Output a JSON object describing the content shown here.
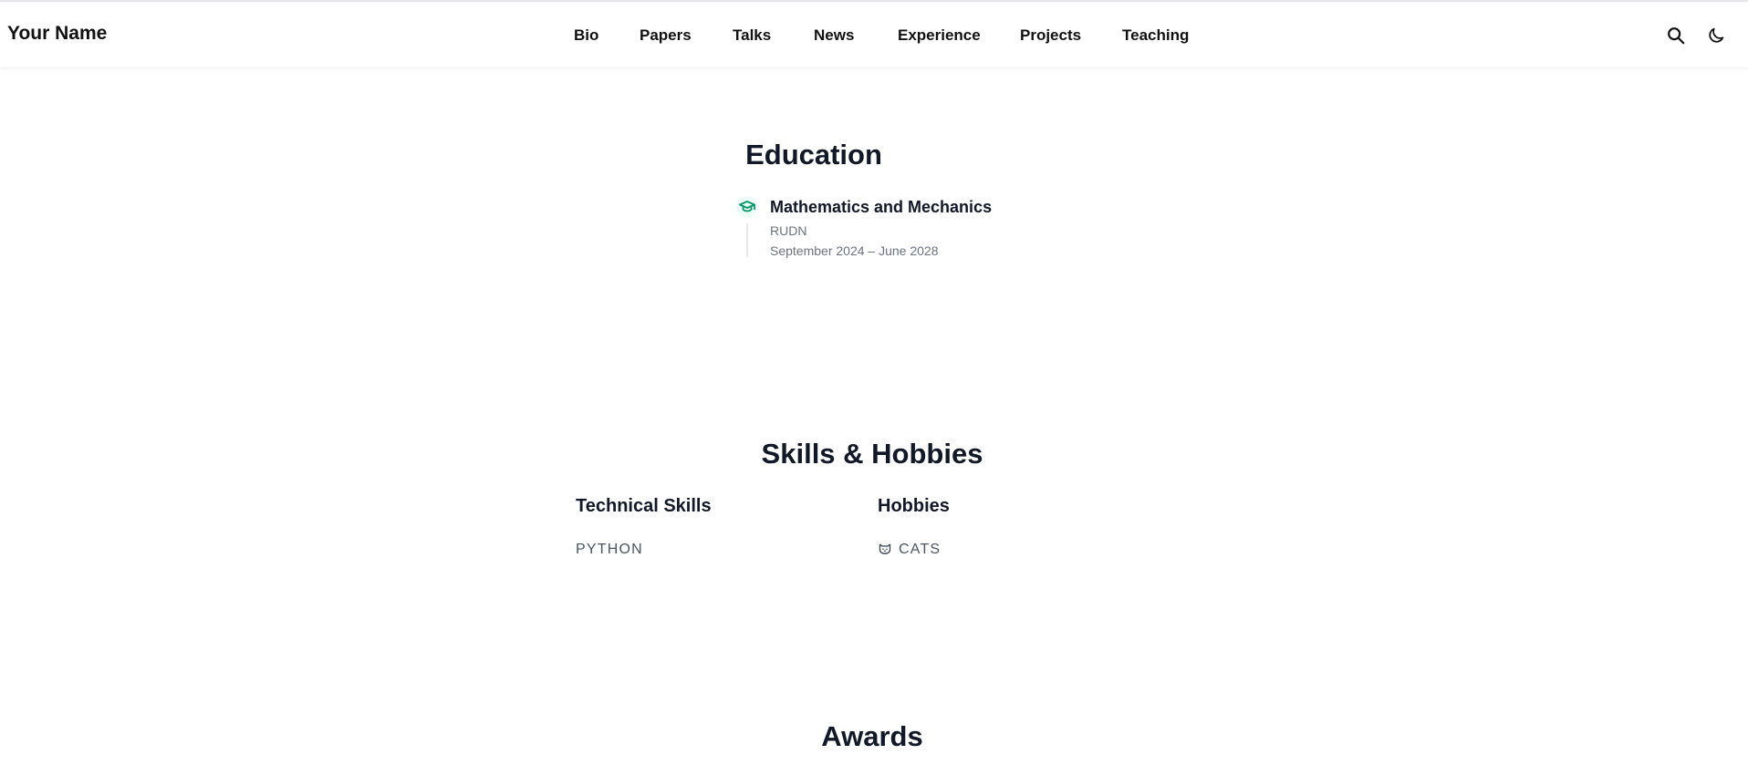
{
  "header": {
    "brand": "Your Name",
    "nav": [
      "Bio",
      "Papers",
      "Talks",
      "News",
      "Experience",
      "Projects",
      "Teaching"
    ],
    "icons": [
      "search-icon",
      "moon-icon"
    ]
  },
  "education": {
    "title": "Education",
    "items": [
      {
        "degree": "Mathematics and Mechanics",
        "school": "RUDN",
        "dates": "September 2024 – June 2028",
        "icon": "graduation-cap-icon"
      }
    ]
  },
  "skills": {
    "title": "Skills & Hobbies",
    "technical": {
      "title": "Technical Skills",
      "items": [
        "PYTHON"
      ]
    },
    "hobbies": {
      "title": "Hobbies",
      "items": [
        {
          "icon": "cat-icon",
          "label": "CATS"
        }
      ]
    }
  },
  "awards": {
    "title": "Awards"
  },
  "colors": {
    "accent": "#059669",
    "heading": "#111827",
    "muted": "#6b7280"
  }
}
